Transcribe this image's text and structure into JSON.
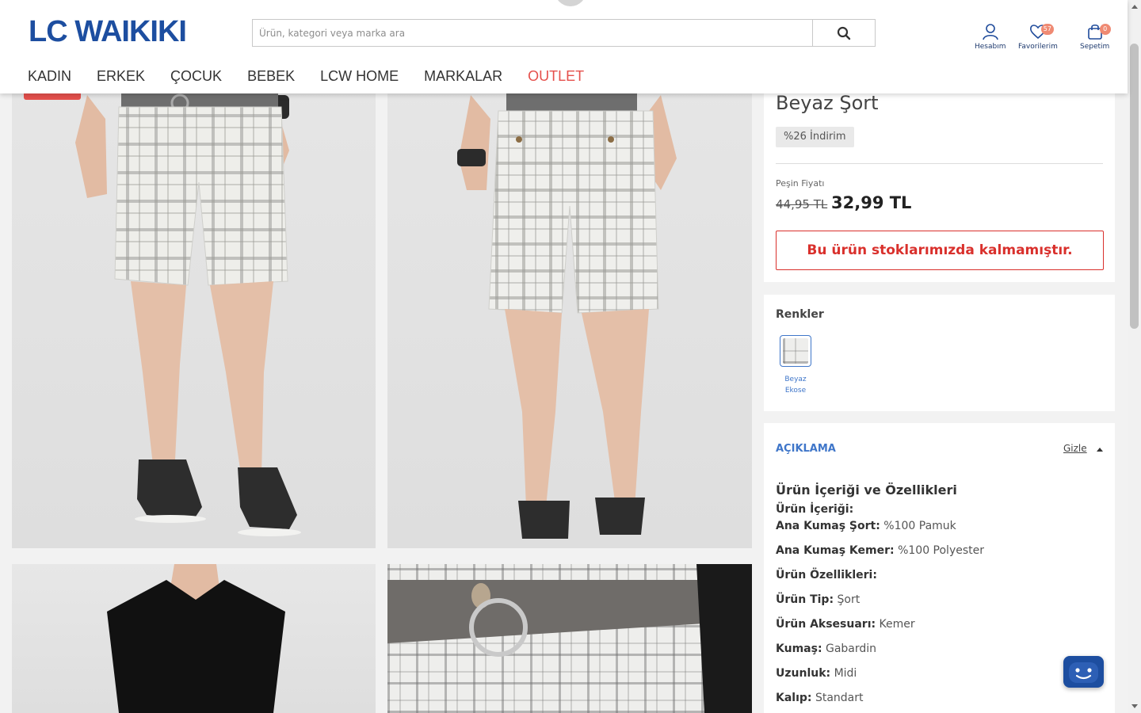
{
  "brand": {
    "logo_text": "LC WAIKIKI",
    "primary_color": "#1d4ea0",
    "accent_red": "#e5504c"
  },
  "search": {
    "placeholder": "Ürün, kategori veya marka ara",
    "button_icon": "search-icon"
  },
  "header_icons": [
    {
      "label": "Hesabım",
      "icon": "user-icon"
    },
    {
      "label": "Favorilerim",
      "icon": "heart-icon",
      "badge": "57"
    },
    {
      "label": "Sepetim",
      "icon": "shopping-bag-icon",
      "badge": "0"
    }
  ],
  "nav": [
    "KADIN",
    "ERKEK",
    "ÇOCUK",
    "BEBEK",
    "LCW HOME",
    "MARKALAR",
    "OUTLET"
  ],
  "product": {
    "title": "Beyaz Şort",
    "discount_badge": "%26 İndirim",
    "price_label": "Peşin Fiyatı",
    "old_price": "44,95 TL",
    "new_price": "32,99 TL",
    "stock_message": "Bu ürün stoklarımızda kalmamıştır."
  },
  "colors": {
    "title": "Renkler",
    "options": [
      {
        "name_line1": "Beyaz",
        "name_line2": "Ekose"
      }
    ]
  },
  "description": {
    "section_title": "AÇIKLAMA",
    "toggle_label": "Gizle",
    "heading": "Ürün İçeriği ve Özellikleri",
    "rows": [
      {
        "key": "Ürün İçeriği:",
        "value": ""
      },
      {
        "key": "Ana Kumaş Şort:",
        "value": " %100 Pamuk"
      },
      {
        "key": "Ana Kumaş Kemer:",
        "value": " %100 Polyester"
      },
      {
        "key": "Ürün Özellikleri:",
        "value": ""
      },
      {
        "key": "Ürün Tip:",
        "value": " Şort"
      },
      {
        "key": "Ürün Aksesuarı:",
        "value": " Kemer"
      },
      {
        "key": "Kumaş:",
        "value": " Gabardin"
      },
      {
        "key": "Uzunluk:",
        "value": " Midi"
      },
      {
        "key": "Kalıp:",
        "value": " Standart"
      }
    ]
  },
  "chat_widget": {
    "icon": "chatbot-face-icon"
  }
}
